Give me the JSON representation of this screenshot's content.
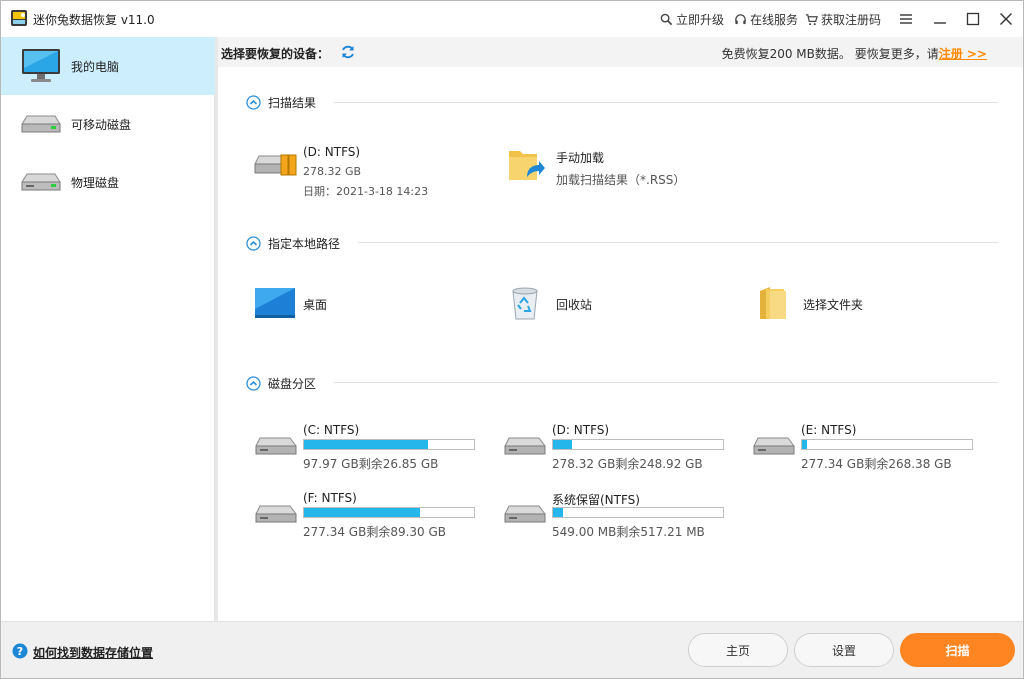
{
  "titlebar": {
    "app_title": "迷你兔数据恢复 v11.0",
    "upgrade": "立即升级",
    "online_service": "在线服务",
    "get_code": "获取注册码"
  },
  "sidebar": {
    "items": [
      {
        "label": "我的电脑",
        "icon": "monitor-icon",
        "active": true
      },
      {
        "label": "可移动磁盘",
        "icon": "removable-drive-icon"
      },
      {
        "label": "物理磁盘",
        "icon": "physical-disk-icon"
      }
    ]
  },
  "devbar": {
    "title": "选择要恢复的设备：",
    "promo": "免费恢复200 MB数据。 要恢复更多，请",
    "register": "注册 >>"
  },
  "sections": {
    "scan_results": {
      "title": "扫描结果",
      "items": [
        {
          "name": "(D: NTFS)",
          "size": "278.32 GB",
          "date": "日期：2021-3-18 14:23"
        },
        {
          "name": "手动加载",
          "sub": "加载扫描结果（*.RSS）"
        }
      ]
    },
    "local_path": {
      "title": "指定本地路径",
      "items": [
        {
          "name": "桌面"
        },
        {
          "name": "回收站"
        },
        {
          "name": "选择文件夹"
        }
      ]
    },
    "partitions": {
      "title": "磁盘分区",
      "items": [
        {
          "name": "(C: NTFS)",
          "info": "97.97 GB剩余26.85 GB",
          "used_fraction": 0.73
        },
        {
          "name": "(D: NTFS)",
          "info": "278.32 GB剩余248.92 GB",
          "used_fraction": 0.11
        },
        {
          "name": "(E: NTFS)",
          "info": "277.34 GB剩余268.38 GB",
          "used_fraction": 0.03
        },
        {
          "name": "(F: NTFS)",
          "info": "277.34 GB剩余89.30 GB",
          "used_fraction": 0.68
        },
        {
          "name": "系统保留(NTFS)",
          "info": "549.00 MB剩余517.21 MB",
          "used_fraction": 0.06
        }
      ]
    }
  },
  "bottom": {
    "help_link": "如何找到数据存储位置",
    "home": "主页",
    "settings": "设置",
    "scan": "扫描"
  },
  "colors": {
    "accent": "#ff8522",
    "bar_fill": "#25b6ec",
    "active_bg": "#cdeefc"
  }
}
